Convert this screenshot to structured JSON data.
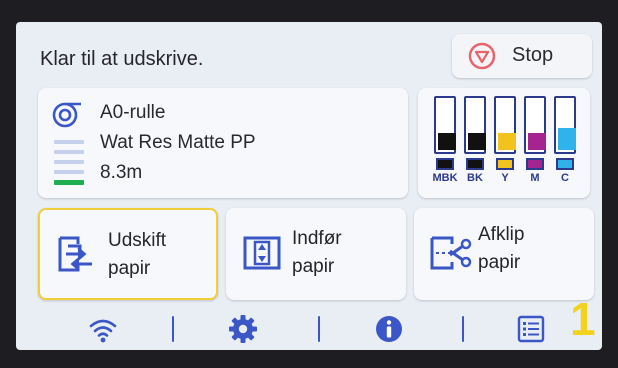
{
  "status": {
    "text": "Klar til at udskrive."
  },
  "stop_button": {
    "label": "Stop",
    "icon": "stop-icon"
  },
  "media": {
    "type": "A0-rulle",
    "name": "Wat Res Matte PP",
    "remaining": "8.3m",
    "icon": "roll-paper-icon"
  },
  "inks": [
    {
      "code": "MBK",
      "color": "#111111",
      "level": 0.3
    },
    {
      "code": "BK",
      "color": "#111111",
      "level": 0.3
    },
    {
      "code": "Y",
      "color": "#f2c21f",
      "level": 0.3
    },
    {
      "code": "M",
      "color": "#a6248f",
      "level": 0.3
    },
    {
      "code": "C",
      "color": "#2fb3ea",
      "level": 0.4
    }
  ],
  "actions": [
    {
      "line1": "Udskift",
      "line2": "papir",
      "icon": "replace-paper-icon",
      "selected": true
    },
    {
      "line1": "Indfør",
      "line2": "papir",
      "icon": "feed-paper-icon",
      "selected": false
    },
    {
      "line1": "Afklip",
      "line2": "papir",
      "icon": "cut-paper-icon",
      "selected": false
    }
  ],
  "bottom_bar": {
    "icons": [
      "wifi-icon",
      "settings-gear-icon",
      "info-icon",
      "job-list-icon"
    ]
  },
  "overlay_number": "1",
  "colors": {
    "accent": "#3b56c7",
    "stop_red": "#e8646a",
    "selection": "#f1cf3a",
    "paper_bar_green": "#1fae4d"
  }
}
